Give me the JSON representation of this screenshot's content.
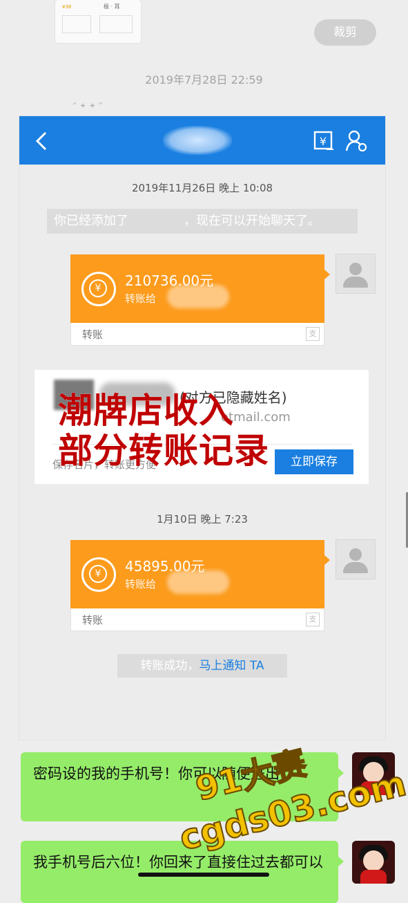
{
  "top": {
    "thumb_tag": "¥38",
    "thumb_title": "极 · 耳",
    "crop_label": "裁剪",
    "timestamp": "2019年7月28日 22:59"
  },
  "screenshot": {
    "nav_color": "#1a7fe0",
    "time1": "2019年11月26日 晚上 10:08",
    "added_prefix": "你已经添加了",
    "added_suffix": "，现在可以开始聊天了。",
    "transfer1": {
      "amount": "210736.00元",
      "to": "转账给",
      "label": "转账"
    },
    "contact": {
      "note": "(对方已隐藏姓名)",
      "email": "otmail.com",
      "hint": "保存名片，转账更方便",
      "save_label": "立即保存"
    },
    "overlay_lines": [
      "潮牌店收入",
      "部分转账记录"
    ],
    "time2": "1月10日 晚上 7:23",
    "transfer2": {
      "amount": "45895.00元",
      "to": "转账给",
      "label": "转账"
    },
    "success_text": "转账成功，",
    "notify_link": "马上通知 TA"
  },
  "chat": {
    "msg1": "密码设的我的手机号！你可以随便进出",
    "msg2": "我手机号后六位！你回来了直接住过去都可以",
    "bubble_color": "#95ec69"
  },
  "watermark": {
    "line1": "91大赛",
    "line2": "cgds03.com"
  }
}
